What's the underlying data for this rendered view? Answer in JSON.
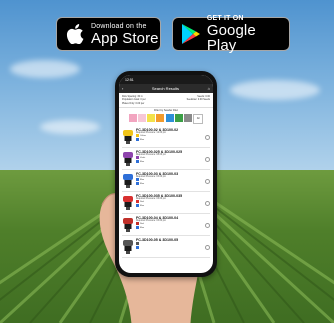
{
  "badges": {
    "apple": {
      "small": "Download on the",
      "big": "App Store",
      "icon": "apple-icon"
    },
    "google": {
      "small": "GET IT ON",
      "big": "Google Play",
      "icon": "google-play-icon"
    }
  },
  "app": {
    "status_time": "12:51",
    "title": "Search Results",
    "info": [
      {
        "left": "Row Spacing: 30 in",
        "right": "Seeds: 0.00"
      },
      {
        "left": "Population Goal: 0 per",
        "right": "Seeds/ac: 0.00 Seeds"
      },
      {
        "left": "Plates Only: 0.00 per",
        "right": ""
      }
    ],
    "filter_title": "Filter by Seeder Disc",
    "swatches": [
      {
        "label": "",
        "color": "#f2a5c0"
      },
      {
        "label": "",
        "color": "#f7c7d7"
      },
      {
        "label": "",
        "color": "#f3e24b"
      },
      {
        "label": "",
        "color": "#f39b2b"
      },
      {
        "label": "",
        "color": "#2e8fd8"
      },
      {
        "label": "",
        "color": "#3b9f45"
      },
      {
        "label": "",
        "color": "#8a8a8a"
      },
      {
        "label": "All",
        "color": "#ffffff"
      }
    ],
    "results": [
      {
        "name": "FC-3D100-02 & 3D100-02",
        "sub": "Required Pressure: 12.00 psi",
        "c1": "Yellow",
        "c2": "Blue",
        "top": "#f0c419",
        "bot": "#1a1a1a"
      },
      {
        "name": "FC-3D100-025 & 3D100-025",
        "sub": "Required Pressure: 08.00 psi",
        "c1": "Violet",
        "c2": "Blue",
        "top": "#8e44ad",
        "bot": "#1a1a1a"
      },
      {
        "name": "FC-3D100-03 & 3D100-03",
        "sub": "Required Pressure: 03.00 psi",
        "c1": "Blue",
        "c2": "Blue",
        "top": "#2e6fd8",
        "bot": "#1a1a1a"
      },
      {
        "name": "FC-3D100-035 & 3D100-035",
        "sub": "Required Pressure: 03.00 psi",
        "c1": "Red",
        "c2": "Blue",
        "top": "#d83030",
        "bot": "#1a1a1a"
      },
      {
        "name": "FC-3D100-04 & 3D100-04",
        "sub": "Required Pressure: 03.00 psi",
        "c1": "Red",
        "c2": "Blue",
        "top": "#c0302a",
        "bot": "#1a1a1a"
      },
      {
        "name": "FC-3D100-05 & 3D100-05",
        "sub": "",
        "c1": "",
        "c2": "",
        "top": "#555",
        "bot": "#1a1a1a"
      }
    ]
  }
}
